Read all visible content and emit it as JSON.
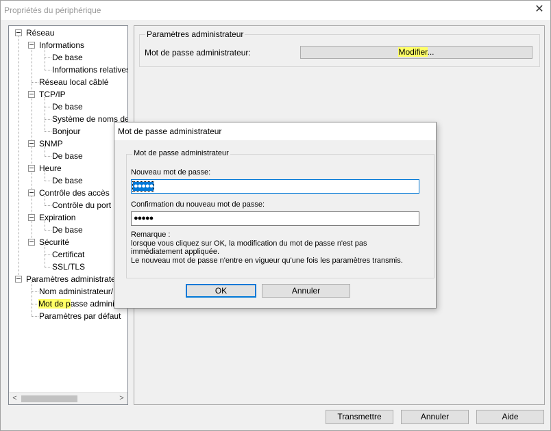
{
  "window": {
    "title": "Propriétés du périphérique"
  },
  "tree": {
    "items": [
      {
        "label": "Réseau"
      },
      {
        "label": "Informations"
      },
      {
        "label": "De base"
      },
      {
        "label": "Informations relatives"
      },
      {
        "label": "Réseau local câblé"
      },
      {
        "label": "TCP/IP"
      },
      {
        "label": "De base"
      },
      {
        "label": "Système de noms de"
      },
      {
        "label": "Bonjour"
      },
      {
        "label": "SNMP"
      },
      {
        "label": "De base"
      },
      {
        "label": "Heure"
      },
      {
        "label": "De base"
      },
      {
        "label": "Contrôle des accès"
      },
      {
        "label": "Contrôle du port"
      },
      {
        "label": "Expiration"
      },
      {
        "label": "De base"
      },
      {
        "label": "Sécurité"
      },
      {
        "label": "Certificat"
      },
      {
        "label": "SSL/TLS"
      },
      {
        "label": "Paramètres administrateur"
      },
      {
        "label": "Nom administrateur/"
      },
      {
        "label_hl": "Mot de p",
        "label_rest": "asse administrateur"
      },
      {
        "label": "Paramètres par défaut"
      }
    ],
    "scroll_left": "<",
    "scroll_right": ">"
  },
  "panel": {
    "group_label": "Paramètres administrateur",
    "password_label": "Mot de passe administrateur:",
    "modify_hl": "Modifier",
    "modify_rest": "..."
  },
  "dialog": {
    "title": "Mot de passe administrateur",
    "group_label": "Mot de passe administrateur",
    "new_password_label": "Nouveau mot de passe:",
    "new_password_value": "●●●●●",
    "confirm_label": "Confirmation du nouveau mot de passe:",
    "confirm_value": "●●●●●",
    "note_title": "Remarque :",
    "note_line1": "lorsque vous cliquez sur OK, la modification du mot de passe n'est pas immédiatement appliquée.",
    "note_line2": "Le nouveau mot de passe n'entre en vigueur qu'une fois les paramètres transmis.",
    "ok_label": "OK",
    "cancel_label": "Annuler"
  },
  "footer": {
    "transmit_label": "Transmettre",
    "cancel_label": "Annuler",
    "help_label": "Aide"
  },
  "colors": {
    "highlight": "#ffff66",
    "selection": "#0078d7",
    "focus_border": "#0078d7"
  }
}
